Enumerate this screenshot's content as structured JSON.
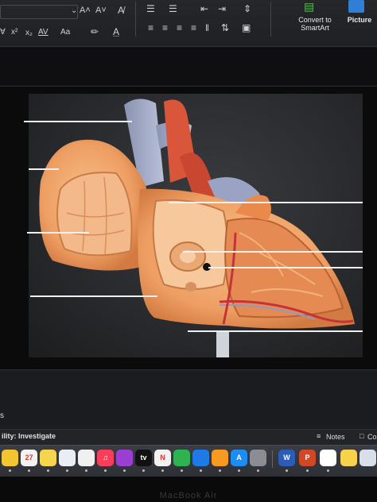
{
  "ribbon": {
    "font_grow": "A˄",
    "font_shrink": "A˅",
    "clear_format": "A̸",
    "superscript": "x²",
    "subscript": "x₂",
    "char_spacing": "AV",
    "change_case": "Aa",
    "highlight_icon": "highlighter-icon",
    "font_color_icon": "font-color-icon",
    "convert_smartart": "Convert to SmartArt",
    "picture": "Picture"
  },
  "status": {
    "accessibility": "ility: Investigate",
    "notes": "Notes",
    "comments": "Co"
  },
  "left_edge": {
    "panel_letter": "s"
  },
  "dock": {
    "apps": [
      {
        "name": "notes-app",
        "label": "",
        "color": "#f3c531"
      },
      {
        "name": "calendar-app",
        "label": "27",
        "color": "#f2f2f2"
      },
      {
        "name": "stickies-app",
        "label": "",
        "color": "#f6d54e"
      },
      {
        "name": "freeform-app",
        "label": "",
        "color": "#e9eef5"
      },
      {
        "name": "reminders-app",
        "label": "",
        "color": "#f0f0f0"
      },
      {
        "name": "music-app",
        "label": "♫",
        "color": "#fa3e5a"
      },
      {
        "name": "podcasts-app",
        "label": "",
        "color": "#9b3fd3"
      },
      {
        "name": "tv-app",
        "label": "tv",
        "color": "#111111"
      },
      {
        "name": "news-app",
        "label": "N",
        "color": "#f2f2f2"
      },
      {
        "name": "numbers-app",
        "label": "",
        "color": "#2fb350"
      },
      {
        "name": "keynote-app",
        "label": "",
        "color": "#1f7ae6"
      },
      {
        "name": "pages-app",
        "label": "",
        "color": "#f79a21"
      },
      {
        "name": "app-store",
        "label": "A",
        "color": "#1c8df2"
      },
      {
        "name": "system-settings",
        "label": "",
        "color": "#8a8d93"
      },
      {
        "name": "word-app",
        "label": "W",
        "color": "#2b5cb8"
      },
      {
        "name": "powerpoint-app",
        "label": "P",
        "color": "#d24725"
      },
      {
        "name": "chrome-app",
        "label": "",
        "color": "#ffffff"
      },
      {
        "name": "notes-yellow-app",
        "label": "",
        "color": "#f6d24d"
      },
      {
        "name": "preview-app",
        "label": "",
        "color": "#d8dfe8"
      }
    ]
  },
  "bezel": {
    "brand": "MacBook Air"
  }
}
